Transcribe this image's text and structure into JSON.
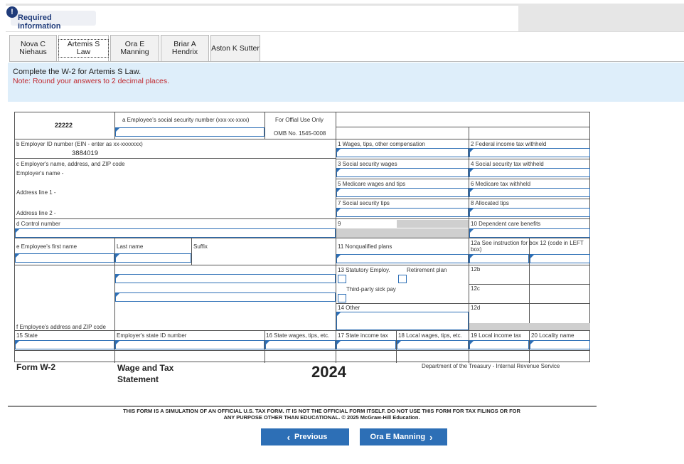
{
  "header": {
    "required_label": "Required information",
    "alert_icon": "!"
  },
  "tabs": [
    {
      "label": "Nova C\nNiehaus",
      "active": false
    },
    {
      "label": "Artemis S Law",
      "active": true
    },
    {
      "label": "Ora E Manning",
      "active": false
    },
    {
      "label": "Briar A\nHendrix",
      "active": false
    },
    {
      "label": "Aston K Sutter",
      "active": false
    }
  ],
  "instructions": {
    "main": "Complete the W-2 for Artemis S Law.",
    "note": "Note: Round your answers to 2 decimal places."
  },
  "w2": {
    "control_code": "22222",
    "ssn_label": "a  Employee's social security number (xxx-xx-xxxx)",
    "official_use": "For Offial Use Only",
    "omb": "OMB No. 1545-0008",
    "ein_label": "b  Employer ID number (EIN - enter as xx-xxxxxxx)",
    "ein_value": "3884019",
    "employer_label": "c  Employer's name, address, and ZIP code",
    "employer_name_label": "Employer's name -",
    "address1_label": "Address line 1 -",
    "address2_label": "Address line 2 -",
    "control_label": "d  Control number",
    "first_name_label": "e  Employee's first name",
    "last_name_label": "Last name",
    "suffix_label": "Suffix",
    "emp_address_label": "f  Employee's address and ZIP code",
    "box1": "1  Wages, tips, other compensation",
    "box2": "2  Federal income tax withheld",
    "box3": "3  Social security wages",
    "box4": "4  Social security tax withheld",
    "box5": "5  Medicare wages and tips",
    "box6": "6  Medicare tax withheld",
    "box7": "7  Social security tips",
    "box8": "8  Allocated tips",
    "box9": "9",
    "box10": "10 Dependent care benefits",
    "box11": "11 Nonqualified plans",
    "box12a": "12a See instruction for box 12 (code in LEFT box)",
    "box13": "13 Statutory Employ.",
    "retirement": "Retirement plan",
    "sick_pay": "Third-party sick pay",
    "box12b": "12b",
    "box12c": "12c",
    "box12d": "12d",
    "box14": "14 Other",
    "box15": "15 State",
    "state_id": "Employer's state ID number",
    "box16": "16 State wages, tips, etc.",
    "box17": "17 State income tax",
    "box18": "18 Local wages, tips, etc.",
    "box19": "19 Local income tax",
    "box20": "20 Locality name"
  },
  "footer": {
    "form_name": "Form W-2",
    "title": "Wage and Tax Statement",
    "year": "2024",
    "dept": "Department of the Treasury - Internal Revenue Service",
    "disclaimer": "THIS FORM IS A SIMULATION OF AN OFFICIAL U.S. TAX FORM. IT IS NOT THE OFFICIAL FORM ITSELF. DO NOT USE THIS FORM FOR TAX FILINGS OR FOR ANY PURPOSE OTHER THAN EDUCATIONAL. © 2025 McGraw-Hill Education."
  },
  "nav": {
    "prev_label": "Previous",
    "next_label": "Ora E Manning"
  },
  "colors": {
    "accent": "#2d6fb6",
    "note": "#c0282e",
    "banner": "#deeefa"
  }
}
